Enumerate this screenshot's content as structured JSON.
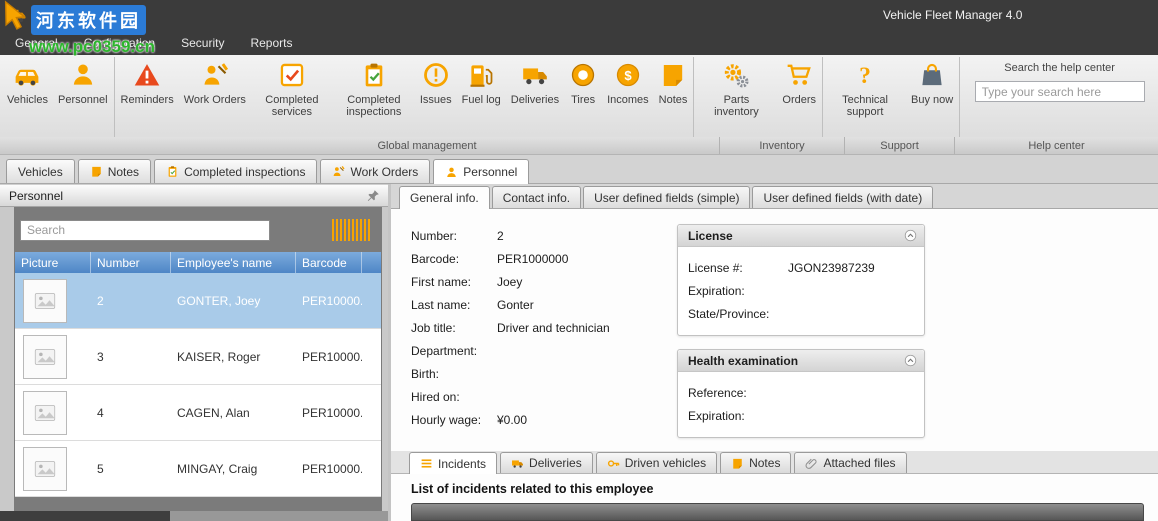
{
  "window": {
    "title": "Vehicle Fleet Manager 4.0"
  },
  "watermark": {
    "site": "河东软件园",
    "url": "www.pc0359.cn"
  },
  "menu": {
    "items": [
      {
        "label": "General"
      },
      {
        "label": "Configuration"
      },
      {
        "label": "Security"
      },
      {
        "label": "Reports"
      }
    ]
  },
  "ribbon": {
    "buttons": [
      {
        "label": "Vehicles"
      },
      {
        "label": "Personnel"
      },
      {
        "label": "Reminders"
      },
      {
        "label": "Work Orders"
      },
      {
        "label": "Completed services"
      },
      {
        "label": "Completed inspections"
      },
      {
        "label": "Issues"
      },
      {
        "label": "Fuel log"
      },
      {
        "label": "Deliveries"
      },
      {
        "label": "Tires"
      },
      {
        "label": "Incomes"
      },
      {
        "label": "Notes"
      },
      {
        "label": "Parts inventory"
      },
      {
        "label": "Orders"
      },
      {
        "label": "Technical support"
      },
      {
        "label": "Buy now"
      }
    ],
    "captions": [
      {
        "label": "Global management"
      },
      {
        "label": "Inventory"
      },
      {
        "label": "Support"
      },
      {
        "label": "Help center"
      }
    ],
    "help": {
      "label": "Search the help center",
      "placeholder": "Type your search here"
    }
  },
  "doc_tabs": [
    {
      "label": "Vehicles"
    },
    {
      "label": "Notes"
    },
    {
      "label": "Completed inspections"
    },
    {
      "label": "Work Orders"
    },
    {
      "label": "Personnel"
    }
  ],
  "left": {
    "title": "Personnel",
    "search_placeholder": "Search",
    "columns": [
      {
        "label": "Picture"
      },
      {
        "label": "Number"
      },
      {
        "label": "Employee's name"
      },
      {
        "label": "Barcode"
      }
    ],
    "rows": [
      {
        "number": "2",
        "name": "GONTER, Joey",
        "barcode": "PER10000..."
      },
      {
        "number": "3",
        "name": "KAISER, Roger",
        "barcode": "PER10000..."
      },
      {
        "number": "4",
        "name": "CAGEN, Alan",
        "barcode": "PER10000..."
      },
      {
        "number": "5",
        "name": "MINGAY, Craig",
        "barcode": "PER10000..."
      }
    ]
  },
  "detail": {
    "tabs": [
      {
        "label": "General info."
      },
      {
        "label": "Contact info."
      },
      {
        "label": "User defined fields (simple)"
      },
      {
        "label": "User defined fields (with date)"
      }
    ],
    "fields": [
      {
        "label": "Number:",
        "value": "2"
      },
      {
        "label": "Barcode:",
        "value": "PER1000000"
      },
      {
        "label": "First name:",
        "value": "Joey"
      },
      {
        "label": "Last name:",
        "value": "Gonter"
      },
      {
        "label": "Job title:",
        "value": "Driver and technician"
      },
      {
        "label": "Department:",
        "value": ""
      },
      {
        "label": "Birth:",
        "value": ""
      },
      {
        "label": "Hired on:",
        "value": ""
      },
      {
        "label": "Hourly wage:",
        "value": "¥0.00"
      }
    ],
    "license": {
      "title": "License",
      "fields": [
        {
          "label": "License #:",
          "value": "JGON23987239"
        },
        {
          "label": "Expiration:",
          "value": ""
        },
        {
          "label": "State/Province:",
          "value": ""
        }
      ]
    },
    "health": {
      "title": "Health examination",
      "fields": [
        {
          "label": "Reference:",
          "value": ""
        },
        {
          "label": "Expiration:",
          "value": ""
        }
      ]
    },
    "bottom_tabs": [
      {
        "label": "Incidents"
      },
      {
        "label": "Deliveries"
      },
      {
        "label": "Driven vehicles"
      },
      {
        "label": "Notes"
      },
      {
        "label": "Attached files"
      }
    ],
    "incidents_heading": "List of incidents related to this employee"
  }
}
